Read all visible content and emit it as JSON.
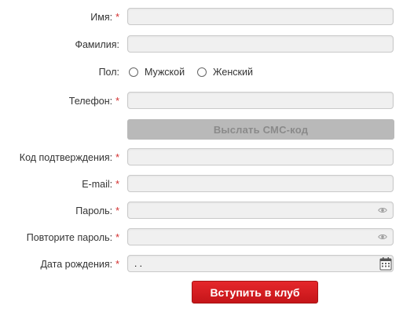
{
  "form": {
    "fields": {
      "first_name": {
        "label": "Имя:",
        "required_mark": "*",
        "value": ""
      },
      "last_name": {
        "label": "Фамилия:",
        "value": ""
      },
      "gender": {
        "label": "Пол:",
        "options": [
          "Мужской",
          "Женский"
        ]
      },
      "phone": {
        "label": "Телефон:",
        "required_mark": "*",
        "value": ""
      },
      "sms_button_label": "Выслать СМС-код",
      "code": {
        "label": "Код подтверждения:",
        "required_mark": "*",
        "value": ""
      },
      "email": {
        "label": "E-mail:",
        "required_mark": "*",
        "value": ""
      },
      "password": {
        "label": "Пароль:",
        "required_mark": "*",
        "value": ""
      },
      "password_repeat": {
        "label": "Повторите пароль:",
        "required_mark": "*",
        "value": ""
      },
      "birth_date": {
        "label": "Дата рождения:",
        "required_mark": "*",
        "value": ". ."
      }
    },
    "submit_label": "Вступить в клуб"
  },
  "colors": {
    "required": "#d32f2f",
    "submit_bg": "#d61e22",
    "sms_bg": "#b9b9b9"
  },
  "icons": {
    "password_toggle": "eye-icon",
    "date_picker": "calendar-icon"
  }
}
